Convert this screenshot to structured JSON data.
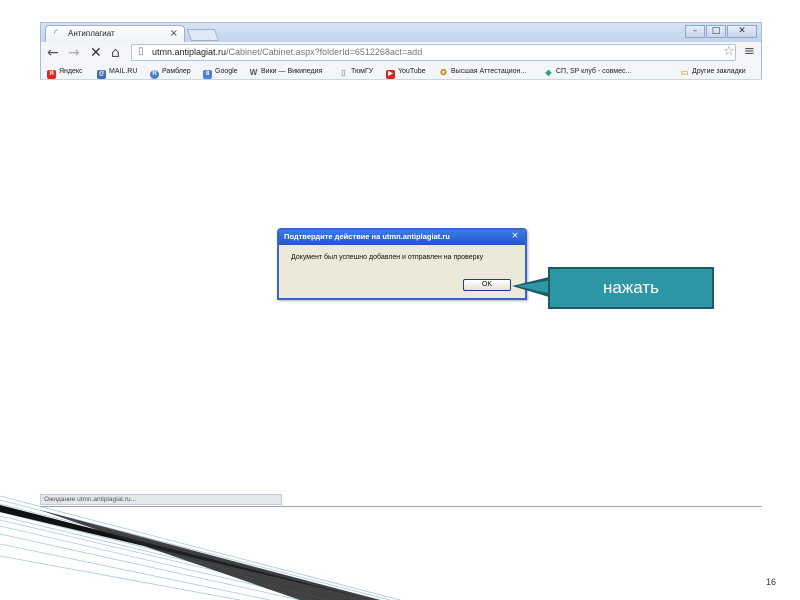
{
  "browser": {
    "tab_title": "Антиплагиат",
    "tab_close": "×",
    "window_buttons": {
      "minimize": "–",
      "maximize": "□",
      "close": "✕"
    },
    "nav": {
      "back": "←",
      "forward": "→",
      "stop": "✕",
      "home": "⌂"
    },
    "address": {
      "host": "utmn.antiplagiat.ru",
      "path": "/Cabinet/Cabinet.aspx?folderId=6512268act=add"
    },
    "star": "☆",
    "menu": "≡",
    "bookmarks": [
      {
        "label": "Яндекс",
        "icon": "yandex-icon",
        "glyph": "Я",
        "color": "#e52620"
      },
      {
        "label": "MAIL.RU",
        "icon": "mailru-icon",
        "glyph": "@",
        "color": "#3d6db3"
      },
      {
        "label": "Рамблер",
        "icon": "rambler-icon",
        "glyph": "R",
        "color": "#4a7fc6"
      },
      {
        "label": "Google",
        "icon": "google-icon",
        "glyph": "8",
        "color": "#4480e6"
      },
      {
        "label": "Вики — Википедия",
        "icon": "wikipedia-icon",
        "glyph": "W",
        "color": "#555555"
      },
      {
        "label": "ТюмГУ",
        "icon": "page-icon",
        "glyph": "▯",
        "color": "#9aa4b2"
      },
      {
        "label": "YouTube",
        "icon": "youtube-icon",
        "glyph": "▶",
        "color": "#d62a1e"
      },
      {
        "label": "Высшая Аттестацион...",
        "icon": "vak-icon",
        "glyph": "✪",
        "color": "#c98a1c"
      },
      {
        "label": "СП, SP клуб - совмес...",
        "icon": "sp-icon",
        "glyph": "◆",
        "color": "#2aa889"
      },
      {
        "label": "Другие закладки",
        "icon": "folder-icon",
        "glyph": "▭",
        "color": "#e0b03a"
      }
    ],
    "status_text": "Ожидание utmn.antiplagiat.ru..."
  },
  "dialog": {
    "title": "Подтвердите действие на utmn.antiplagiat.ru",
    "close": "×",
    "message": "Документ был успешно добавлен и отправлен на проверку",
    "ok_label": "OK"
  },
  "callout": {
    "text": "нажать",
    "color": "#2e97a6"
  },
  "slide": {
    "page_number": "16"
  }
}
